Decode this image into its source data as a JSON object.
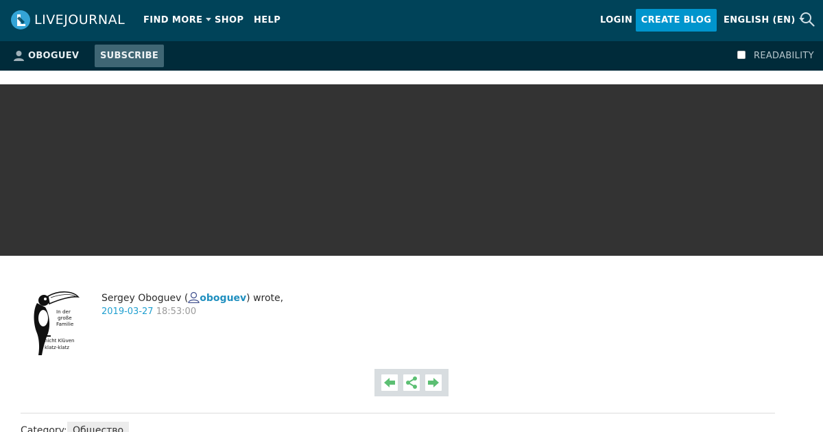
{
  "header": {
    "logo_text": "LIVEJOURNAL",
    "nav": {
      "find_more": "FIND MORE",
      "shop": "SHOP",
      "help": "HELP"
    },
    "login": "LOGIN",
    "create_blog": "CREATE BLOG",
    "language": "ENGLISH (EN)"
  },
  "subbar": {
    "username": "OBOGUEV",
    "subscribe": "SUBSCRIBE",
    "readability": "READABILITY",
    "readability_checked": false
  },
  "post": {
    "author_name": "Sergey Oboguev (",
    "author_user": "oboguev",
    "wrote": ") wrote,",
    "date": "2019-03-27",
    "time": "18:53:00",
    "avatar_text": [
      "In der",
      "große",
      "Familie",
      "nicht Klüven",
      "klatz-klatz"
    ]
  },
  "footer": {
    "category_label": "Category:",
    "category_tag": "Общество"
  },
  "colors": {
    "topbar": "#004359",
    "subbar": "#002b3a",
    "accent": "#0095cd",
    "banner": "#333333",
    "nav_arrow": "#5cbf73"
  }
}
